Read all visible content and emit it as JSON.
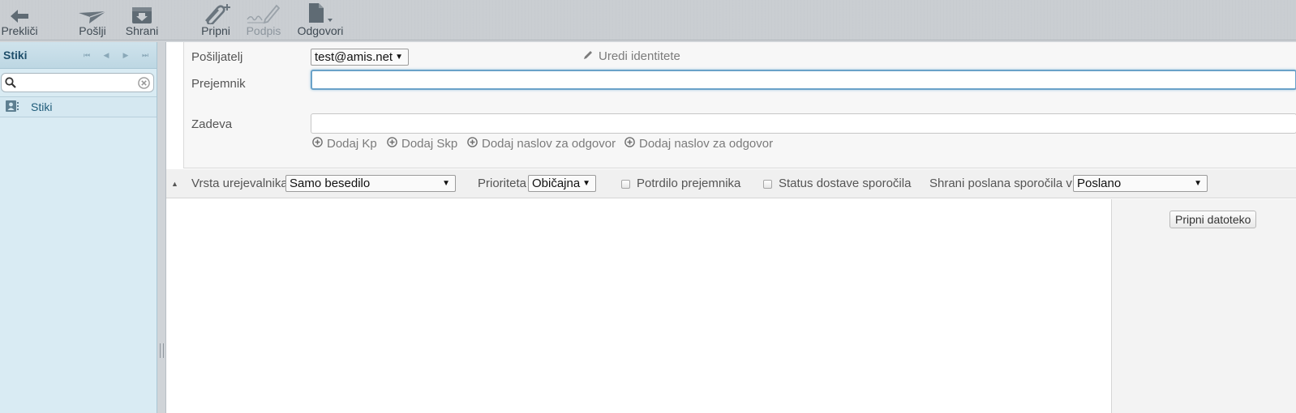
{
  "toolbar": {
    "cancel": "Prekliči",
    "send": "Pošlji",
    "save": "Shrani",
    "attach": "Pripni",
    "signature": "Podpis",
    "responses": "Odgovori"
  },
  "sidebar": {
    "title": "Stiki",
    "search_value": "",
    "addressbooks": [
      {
        "label": "Stiki"
      }
    ]
  },
  "compose": {
    "from_label": "Pošiljatelj",
    "from_value": "test@amis.net",
    "edit_identities": "Uredi identitete",
    "to_label": "Prejemnik",
    "to_value": "",
    "add_cc": "Dodaj Kp",
    "add_bcc": "Dodaj Skp",
    "add_reply_to": "Dodaj naslov za odgovor",
    "add_followup_to": "Dodaj naslov za odgovor",
    "subject_label": "Zadeva",
    "subject_value": ""
  },
  "options": {
    "editor_type_label": "Vrsta urejevalnika",
    "editor_type_value": "Samo besedilo",
    "priority_label": "Prioriteta",
    "priority_value": "Običajna",
    "read_receipt_label": "Potrdilo prejemnika",
    "dsn_label": "Status dostave sporočila",
    "store_sent_label": "Shrani poslana sporočila v",
    "store_sent_value": "Poslano"
  },
  "attachments": {
    "attach_button": "Pripni datoteko"
  }
}
